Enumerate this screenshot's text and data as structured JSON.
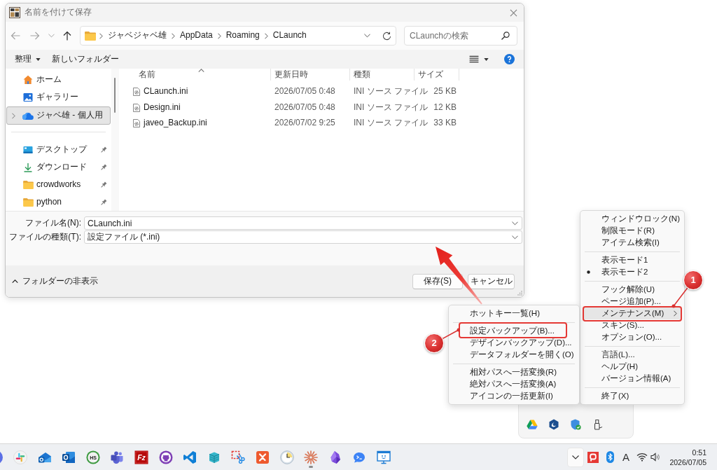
{
  "dialog": {
    "title": "名前を付けて保存",
    "nav_buttons": [
      {
        "kind": "back",
        "disabled": true
      },
      {
        "kind": "forward",
        "disabled": true
      },
      {
        "kind": "recent",
        "disabled": true
      },
      {
        "kind": "up",
        "disabled": false
      }
    ],
    "breadcrumb": [
      "ジャベジャベ雄",
      "AppData",
      "Roaming",
      "CLaunch"
    ],
    "search": {
      "placeholder": "CLaunchの検索"
    },
    "toolbar": {
      "organize": "整理",
      "new_folder": "新しいフォルダー"
    },
    "nav_pane": {
      "groups": [
        [
          {
            "kind": "home",
            "label": "ホーム",
            "selected": false,
            "expandable": false,
            "pinned": false
          },
          {
            "kind": "gallery",
            "label": "ギャラリー",
            "selected": false,
            "expandable": false,
            "pinned": false
          },
          {
            "kind": "cloud",
            "label": "ジャベ雄 - 個人用",
            "selected": true,
            "expandable": true,
            "pinned": false
          }
        ],
        [
          {
            "kind": "desktop",
            "label": "デスクトップ",
            "selected": false,
            "expandable": false,
            "pinned": true
          },
          {
            "kind": "download",
            "label": "ダウンロード",
            "selected": false,
            "expandable": false,
            "pinned": true
          },
          {
            "kind": "folder",
            "label": "crowdworks",
            "selected": false,
            "expandable": false,
            "pinned": true
          },
          {
            "kind": "folder",
            "label": "python",
            "selected": false,
            "expandable": false,
            "pinned": true
          }
        ]
      ]
    },
    "columns": [
      {
        "label": "名前",
        "sorted": true
      },
      {
        "label": "更新日時",
        "sorted": false
      },
      {
        "label": "種類",
        "sorted": false
      },
      {
        "label": "サイズ",
        "sorted": false
      }
    ],
    "files": [
      {
        "name": "CLaunch.ini",
        "modified": "2026/07/05 0:48",
        "type": "INI ソース ファイル",
        "size": "25 KB"
      },
      {
        "name": "Design.ini",
        "modified": "2026/07/05 0:48",
        "type": "INI ソース ファイル",
        "size": "12 KB"
      },
      {
        "name": "javeo_Backup.ini",
        "modified": "2026/07/02 9:25",
        "type": "INI ソース ファイル",
        "size": "33 KB"
      }
    ],
    "file_name": {
      "label": "ファイル名(N):",
      "value": "CLaunch.ini"
    },
    "file_type": {
      "label": "ファイルの種類(T):",
      "value": "設定ファイル (*.ini)"
    },
    "folder_toggle": "フォルダーの非表示",
    "buttons": [
      "保存(S)",
      "キャンセル"
    ]
  },
  "main_menu": {
    "callout": "1",
    "groups": [
      [
        {
          "label": "ウィンドウロック(N)",
          "checked": false,
          "submenu": false,
          "highlighted": false,
          "outlined": false
        },
        {
          "label": "制限モード(R)",
          "checked": false,
          "submenu": false,
          "highlighted": false,
          "outlined": false
        },
        {
          "label": "アイテム検索(I)",
          "checked": false,
          "submenu": false,
          "highlighted": false,
          "outlined": false
        }
      ],
      [
        {
          "label": "表示モード1",
          "checked": false,
          "submenu": false,
          "highlighted": false,
          "outlined": false
        },
        {
          "label": "表示モード2",
          "checked": true,
          "submenu": false,
          "highlighted": false,
          "outlined": false
        }
      ],
      [
        {
          "label": "フック解除(U)",
          "checked": false,
          "submenu": false,
          "highlighted": false,
          "outlined": false
        },
        {
          "label": "ページ追加(P)...",
          "checked": false,
          "submenu": false,
          "highlighted": false,
          "outlined": false
        },
        {
          "label": "メンテナンス(M)",
          "checked": false,
          "submenu": true,
          "highlighted": true,
          "outlined": true
        },
        {
          "label": "スキン(S)...",
          "checked": false,
          "submenu": false,
          "highlighted": false,
          "outlined": false
        },
        {
          "label": "オプション(O)...",
          "checked": false,
          "submenu": false,
          "highlighted": false,
          "outlined": false
        }
      ],
      [
        {
          "label": "言語(L)...",
          "checked": false,
          "submenu": false,
          "highlighted": false,
          "outlined": false
        },
        {
          "label": "ヘルプ(H)",
          "checked": false,
          "submenu": false,
          "highlighted": false,
          "outlined": false
        },
        {
          "label": "バージョン情報(A)",
          "checked": false,
          "submenu": false,
          "highlighted": false,
          "outlined": false
        }
      ],
      [
        {
          "label": "終了(X)",
          "checked": false,
          "submenu": false,
          "highlighted": false,
          "outlined": false
        }
      ]
    ]
  },
  "submenu": {
    "callout": "2",
    "groups": [
      [
        {
          "label": "ホットキー一覧(H)",
          "outlined": false
        }
      ],
      [
        {
          "label": "設定バックアップ(B)...",
          "outlined": true
        },
        {
          "label": "デザインバックアップ(D)...",
          "outlined": false
        },
        {
          "label": "データフォルダーを開く(O)",
          "outlined": false
        }
      ],
      [
        {
          "label": "相対パスへ一括変換(R)",
          "outlined": false
        },
        {
          "label": "絶対パスへ一括変換(A)",
          "outlined": false
        },
        {
          "label": "アイコンの一括更新(I)",
          "outlined": false
        }
      ]
    ]
  },
  "tray_popup": {
    "items": [
      {
        "kind": "triangle"
      },
      {
        "kind": "hexagon"
      },
      {
        "kind": "shield"
      },
      {
        "kind": "usb"
      }
    ]
  },
  "taskbar": {
    "apps": [
      {
        "kind": "disc",
        "running": false
      },
      {
        "kind": "hash",
        "running": false
      },
      {
        "kind": "mailnew",
        "running": false
      },
      {
        "kind": "mail",
        "running": false
      },
      {
        "kind": "badge",
        "label": "HS",
        "running": false
      },
      {
        "kind": "people",
        "running": false
      },
      {
        "kind": "tile",
        "label": "Fz",
        "running": false
      },
      {
        "kind": "catcircle",
        "running": false
      },
      {
        "kind": "ribbon",
        "running": false
      },
      {
        "kind": "servers",
        "running": false
      },
      {
        "kind": "scissors",
        "running": false
      },
      {
        "kind": "crossed",
        "running": false
      },
      {
        "kind": "clock",
        "running": false
      },
      {
        "kind": "starburst",
        "running": true
      },
      {
        "kind": "crystal",
        "running": false
      },
      {
        "kind": "chat",
        "running": false
      },
      {
        "kind": "monitor",
        "running": false
      }
    ],
    "overflow_open": true,
    "ime": "A",
    "time": "0:51",
    "date": "2026/07/05"
  }
}
